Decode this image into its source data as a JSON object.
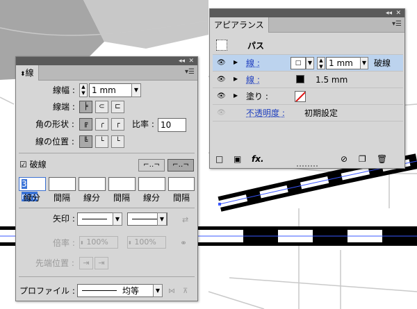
{
  "stroke_panel": {
    "tab_label": "線",
    "weight_label": "線幅 :",
    "weight_value": "1 mm",
    "cap_label": "線端 :",
    "corner_label": "角の形状 :",
    "limit_label": "比率 :",
    "limit_value": "10",
    "align_label": "線の位置 :",
    "dashed_label": "破線",
    "dash_fields": [
      "3 mm",
      "",
      "",
      "",
      "",
      ""
    ],
    "dash_labels": [
      "線分",
      "間隔",
      "線分",
      "間隔",
      "線分",
      "間隔"
    ],
    "arrow_label": "矢印 :",
    "scale_label": "倍率 :",
    "scale_start": "100%",
    "scale_end": "100%",
    "align_arrow_label": "先端位置 :",
    "profile_label": "プロファイル :",
    "profile_value": "均等"
  },
  "appearance_panel": {
    "tab_label": "アピアランス",
    "header_label": "パス",
    "rows": [
      {
        "label": "線 :",
        "weight": "1 mm",
        "extra": "破線"
      },
      {
        "label": "線 :",
        "weight": "1.5 mm"
      },
      {
        "label": "塗り :"
      },
      {
        "label": "不透明度 :",
        "value": "初期設定"
      }
    ],
    "fx_label": "fx."
  },
  "colors": {
    "panel_bg": "#d6d6d6",
    "selection_blue": "#bcd3ee",
    "link_blue": "#1f3fbf",
    "canvas_gray": "#a6a6a6"
  }
}
